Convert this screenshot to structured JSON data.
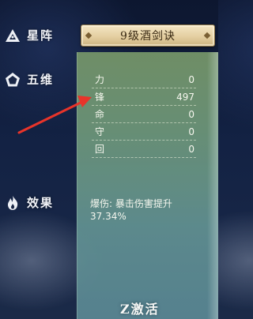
{
  "menu": {
    "xingzhen_label": "星阵",
    "wuwei_label": "五维",
    "xiaoguo_label": "效果"
  },
  "title_button_label": "9级酒剑诀",
  "stats": [
    {
      "label": "力",
      "value": "0"
    },
    {
      "label": "锋",
      "value": "497"
    },
    {
      "label": "命",
      "value": "0"
    },
    {
      "label": "守",
      "value": "0"
    },
    {
      "label": "回",
      "value": "0"
    }
  ],
  "effect": {
    "line1": "爆伤: 暴击伤害提升",
    "line2": "37.34%"
  },
  "activate_label": "Z激活",
  "colors": {
    "arrow": "#e8342a",
    "panel": "#6d9a86",
    "title_button": "#e9d6a8"
  }
}
